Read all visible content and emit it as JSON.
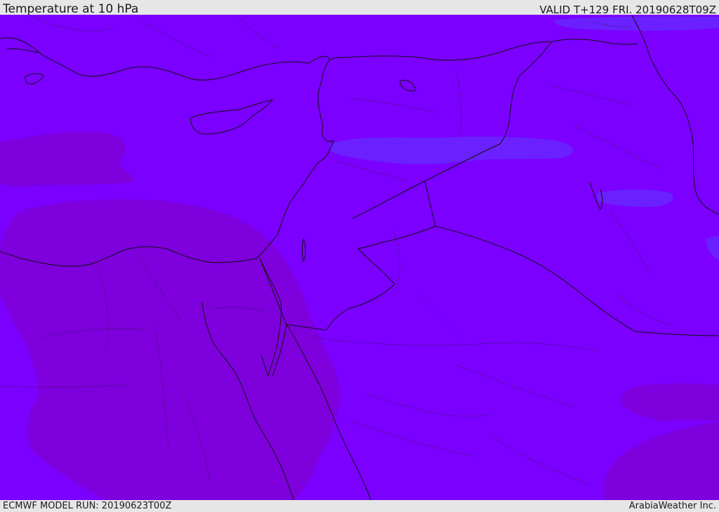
{
  "header": {
    "title": "Temperature at 10 hPa",
    "valid_time": "VALID T+129 FRI. 20190628T09Z"
  },
  "footer": {
    "model_run": "ECMWF MODEL RUN: 20190623T00Z",
    "credit": "ArabiaWeather Inc."
  },
  "colors": {
    "base_field": "#7b00ff",
    "warm_field": "#7d00dd",
    "cool_field": "#6a20ff",
    "coastline": "#111111",
    "border_dotted": "#222222"
  }
}
